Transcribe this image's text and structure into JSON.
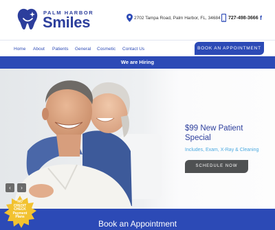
{
  "brand": {
    "small": "PALM HARBOR",
    "big": "Smiles",
    "color": "#2c3e9c"
  },
  "header": {
    "address": "2702 Tampa Road, Palm Harbor, FL, 34684",
    "phone": "727-498-3666",
    "facebook": "f"
  },
  "nav": {
    "items": [
      "Home",
      "About",
      "Patients",
      "General",
      "Cosmetic",
      "Contact Us"
    ],
    "cta": "BOOK AN APPOINTMENT"
  },
  "banner": {
    "hiring": "We are Hiring"
  },
  "hero": {
    "title": "$99 New Patient Special",
    "subtitle": "Includes, Exam, X-Ray & Cleaning",
    "cta": "SCHEDULE NOW",
    "prev": "‹",
    "next": "›"
  },
  "badge": {
    "lines": [
      "NO",
      "CREDIT",
      "CHECK",
      "Payment",
      "Plans"
    ]
  },
  "footer_bar": {
    "label": "Book an Appointment"
  },
  "colors": {
    "accent": "#2c4ab6",
    "subtitle": "#4aa9e0",
    "button_dark": "#4f5152",
    "badge": "#f2c230"
  },
  "icons": [
    "tooth-logo-icon",
    "location-pin-icon",
    "mobile-phone-icon",
    "facebook-icon",
    "chevron-left-icon",
    "chevron-right-icon",
    "starburst-badge-icon"
  ]
}
